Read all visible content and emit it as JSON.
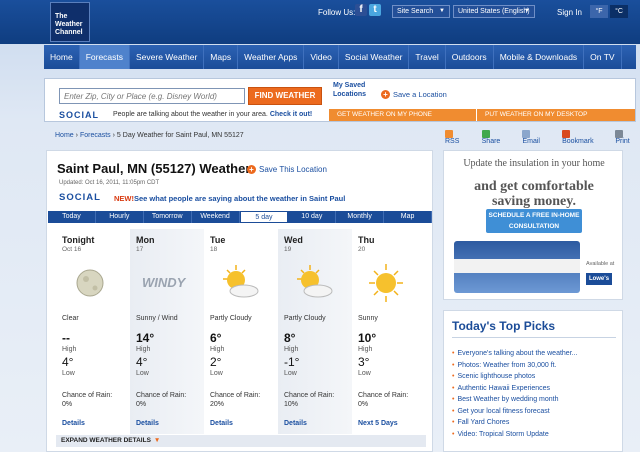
{
  "header": {
    "logo_text": "The Weather Channel",
    "follow_label": "Follow Us:",
    "facebook_icon": "facebook-icon",
    "twitter_icon": "twitter-icon",
    "site_search_label": "Site Search",
    "country_label": "United States (English)",
    "sign_in": "Sign In",
    "unit_f": "°F",
    "unit_c": "°C"
  },
  "nav": {
    "items": [
      {
        "label": "Home"
      },
      {
        "label": "Forecasts"
      },
      {
        "label": "Severe Weather"
      },
      {
        "label": "Maps"
      },
      {
        "label": "Weather Apps"
      },
      {
        "label": "Video"
      },
      {
        "label": "Social Weather"
      },
      {
        "label": "Travel"
      },
      {
        "label": "Outdoors"
      },
      {
        "label": "Mobile & Downloads"
      },
      {
        "label": "On TV"
      }
    ],
    "active": "Forecasts"
  },
  "search": {
    "placeholder": "Enter Zip, City or Place (e.g. Disney World)",
    "button": "FIND WEATHER",
    "social_logo": "SOCIAL",
    "social_text": "People are talking about the weather in your area.",
    "social_link": "Check it out!",
    "saved_locations": "My Saved Locations",
    "save_location": "Save a Location",
    "get_phone": "GET WEATHER ON MY PHONE",
    "get_desktop": "PUT WEATHER ON MY DESKTOP"
  },
  "breadcrumb": {
    "home": "Home",
    "forecasts": "Forecasts",
    "current": "5 Day Weather for Saint Paul, MN 55127"
  },
  "tools": {
    "rss": "RSS",
    "share": "Share",
    "email": "Email",
    "bookmark": "Bookmark",
    "print": "Print"
  },
  "location": {
    "title": "Saint Paul, MN (55127) Weather",
    "save_this": "Save This Location",
    "updated": "Updated: Oct 16, 2011, 11:05pm CDT",
    "social_logo": "SOCIAL",
    "social_new": "NEW!",
    "social_link": "See what people are saying about the weather in Saint Paul"
  },
  "tabs": [
    {
      "label": "Today"
    },
    {
      "label": "Hourly"
    },
    {
      "label": "Tomorrow"
    },
    {
      "label": "Weekend"
    },
    {
      "label": "5 day"
    },
    {
      "label": "10 day"
    },
    {
      "label": "Monthly"
    },
    {
      "label": "Map"
    }
  ],
  "active_tab": "5 day",
  "forecast": [
    {
      "name": "Tonight",
      "date": "Oct 16",
      "icon": "clear-moon-icon",
      "condition": "Clear",
      "high": "--",
      "high_label": "High",
      "low": "4°",
      "low_label": "Low",
      "rain_label": "Chance of Rain:",
      "rain": "0%",
      "link": "Details"
    },
    {
      "name": "Mon",
      "date": "17",
      "icon": "windy-icon",
      "icon_text": "WINDY",
      "condition": "Sunny / Wind",
      "high": "14°",
      "high_label": "High",
      "low": "4°",
      "low_label": "Low",
      "rain_label": "Chance of Rain:",
      "rain": "0%",
      "link": "Details"
    },
    {
      "name": "Tue",
      "date": "18",
      "icon": "partly-cloudy-icon",
      "condition": "Partly Cloudy",
      "high": "6°",
      "high_label": "High",
      "low": "2°",
      "low_label": "Low",
      "rain_label": "Chance of Rain:",
      "rain": "20%",
      "link": "Details"
    },
    {
      "name": "Wed",
      "date": "19",
      "icon": "partly-cloudy-icon",
      "condition": "Partly Cloudy",
      "high": "8°",
      "high_label": "High",
      "low": "-1°",
      "low_label": "Low",
      "rain_label": "Chance of Rain:",
      "rain": "10%",
      "link": "Details"
    },
    {
      "name": "Thu",
      "date": "20",
      "icon": "sunny-icon",
      "condition": "Sunny",
      "high": "10°",
      "high_label": "High",
      "low": "3°",
      "low_label": "Low",
      "rain_label": "Chance of Rain:",
      "rain": "0%",
      "link": "Next 5 Days"
    }
  ],
  "expand": "EXPAND WEATHER DETAILS",
  "ad": {
    "line1": "Update the insulation in your home",
    "line2": "and get comfortable saving money.",
    "button": "SCHEDULE A FREE IN-HOME CONSULTATION",
    "available": "Available at",
    "store": "Lowe's"
  },
  "picks": {
    "title": "Today's Top Picks",
    "items": [
      "Everyone's talking about the weather...",
      "Photos: Weather from 30,000 ft.",
      "Scenic lighthouse photos",
      "Authentic Hawaii Experiences",
      "Best Weather by wedding month",
      "Get your local fitness forecast",
      "Fall Yard Chores",
      "Video: Tropical Storm Update"
    ]
  }
}
